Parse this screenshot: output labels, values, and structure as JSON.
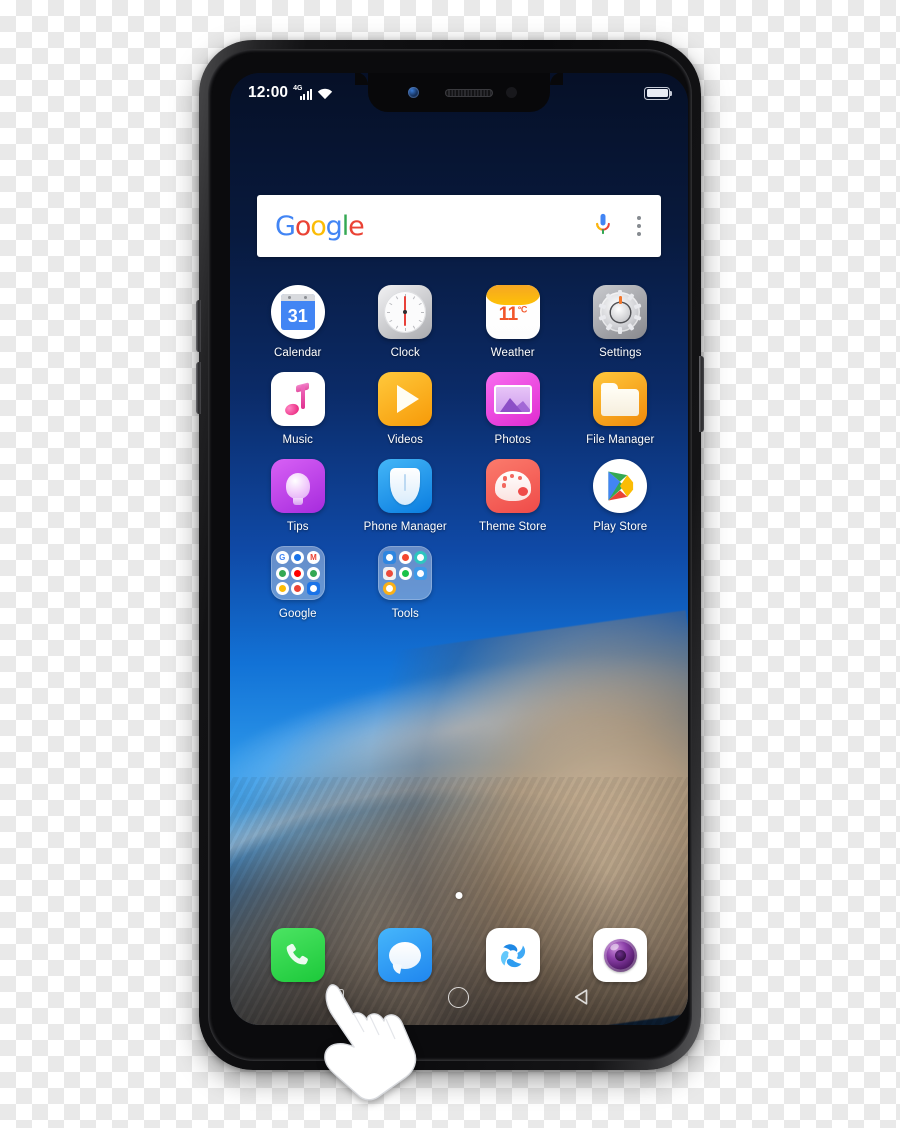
{
  "device": {
    "name": "smartphone-mockup",
    "notch": {
      "front_camera": "front-camera-icon",
      "earpiece": "earpiece-speaker",
      "sensor": "proximity-sensor-icon"
    },
    "buttons": [
      {
        "name": "volume-up-button"
      },
      {
        "name": "volume-down-button"
      },
      {
        "name": "power-button"
      }
    ]
  },
  "status_bar": {
    "time": "12:00",
    "network_label": "4G",
    "signal_icon": "signal-4g-icon",
    "wifi_icon": "wifi-icon",
    "battery_icon": "battery-icon",
    "battery_level_pct": 100
  },
  "search": {
    "logo_letters": [
      {
        "ch": "G",
        "color": "#4285F4"
      },
      {
        "ch": "o",
        "color": "#EA4335"
      },
      {
        "ch": "o",
        "color": "#FBBC05"
      },
      {
        "ch": "g",
        "color": "#4285F4"
      },
      {
        "ch": "l",
        "color": "#34A853"
      },
      {
        "ch": "e",
        "color": "#EA4335"
      }
    ],
    "logo_text": "Google",
    "voice_icon": "voice-search-icon",
    "overflow_icon": "search-overflow-icon"
  },
  "home_screen": {
    "apps": [
      {
        "label": "Calendar",
        "icon": "calendar-icon",
        "badge": "31"
      },
      {
        "label": "Clock",
        "icon": "clock-icon"
      },
      {
        "label": "Weather",
        "icon": "weather-icon",
        "temperature": "11",
        "unit": "°C"
      },
      {
        "label": "Settings",
        "icon": "settings-icon"
      },
      {
        "label": "Music",
        "icon": "music-icon"
      },
      {
        "label": "Videos",
        "icon": "videos-icon"
      },
      {
        "label": "Photos",
        "icon": "photos-icon"
      },
      {
        "label": "File Manager",
        "icon": "file-manager-icon"
      },
      {
        "label": "Tips",
        "icon": "tips-icon"
      },
      {
        "label": "Phone Manager",
        "icon": "phone-manager-icon"
      },
      {
        "label": "Theme Store",
        "icon": "theme-store-icon"
      },
      {
        "label": "Play Store",
        "icon": "play-store-icon"
      },
      {
        "label": "Google",
        "icon": "google-folder-icon"
      },
      {
        "label": "Tools",
        "icon": "tools-folder-icon"
      }
    ],
    "google_folder_apps": [
      {
        "name": "google-search-mini-icon",
        "glyph": "G",
        "bg": "#ffffff",
        "fg": "#4285F4"
      },
      {
        "name": "chrome-mini-icon",
        "glyph": "",
        "bg": "#ffffff",
        "fg": "#1a73e8"
      },
      {
        "name": "gmail-mini-icon",
        "glyph": "M",
        "bg": "#ffffff",
        "fg": "#ea4335"
      },
      {
        "name": "maps-mini-icon",
        "glyph": "",
        "bg": "#ffffff",
        "fg": "#34a853"
      },
      {
        "name": "youtube-mini-icon",
        "glyph": "",
        "bg": "#ffffff",
        "fg": "#ff0000"
      },
      {
        "name": "drive-mini-icon",
        "glyph": "",
        "bg": "#ffffff",
        "fg": "#34a853"
      },
      {
        "name": "play-store-mini-icon",
        "glyph": "",
        "bg": "#ffffff",
        "fg": "#fbbc05"
      },
      {
        "name": "play-movies-mini-icon",
        "glyph": "",
        "bg": "#ffffff",
        "fg": "#ea4335"
      },
      {
        "name": "duo-mini-icon",
        "glyph": "",
        "bg": "#1a73e8",
        "fg": "#ffffff"
      }
    ],
    "tools_folder_apps": [
      {
        "name": "contacts-mini-icon",
        "bg": "#2f86e0",
        "fg": "#ffffff"
      },
      {
        "name": "recorder-mini-icon",
        "bg": "#ffffff",
        "fg": "#f4472f"
      },
      {
        "name": "compass-mini-icon",
        "bg": "#2ec5c0",
        "fg": "#ffffff"
      },
      {
        "name": "calculator-mini-icon",
        "bg": "#f0f1f3",
        "fg": "#ec4a3c"
      },
      {
        "name": "clone-phone-mini-icon",
        "bg": "#ffffff",
        "fg": "#19c24a"
      },
      {
        "name": "notes-mini-icon",
        "bg": "#3e9ae8",
        "fg": "#ffffff"
      },
      {
        "name": "flashlight-mini-icon",
        "bg": "#fbb117",
        "fg": "#ffffff"
      }
    ],
    "page_indicator": {
      "pages": 1,
      "current": 1
    }
  },
  "dock": {
    "items": [
      {
        "name": "phone-dock-icon",
        "label": "Phone",
        "color": "#22c93c"
      },
      {
        "name": "messages-dock-icon",
        "label": "Messages",
        "color": "#2a93f0"
      },
      {
        "name": "browser-dock-icon",
        "label": "Browser",
        "color": "#2196f3"
      },
      {
        "name": "camera-dock-icon",
        "label": "Camera",
        "color": "#7a2f9c"
      }
    ]
  },
  "nav_bar": {
    "buttons": [
      {
        "name": "nav-recents-icon",
        "label": "Recents"
      },
      {
        "name": "nav-home-icon",
        "label": "Home"
      },
      {
        "name": "nav-back-icon",
        "label": "Back"
      }
    ]
  },
  "cursor": {
    "name": "hand-tap-cursor",
    "target": "nav-recents-icon"
  }
}
